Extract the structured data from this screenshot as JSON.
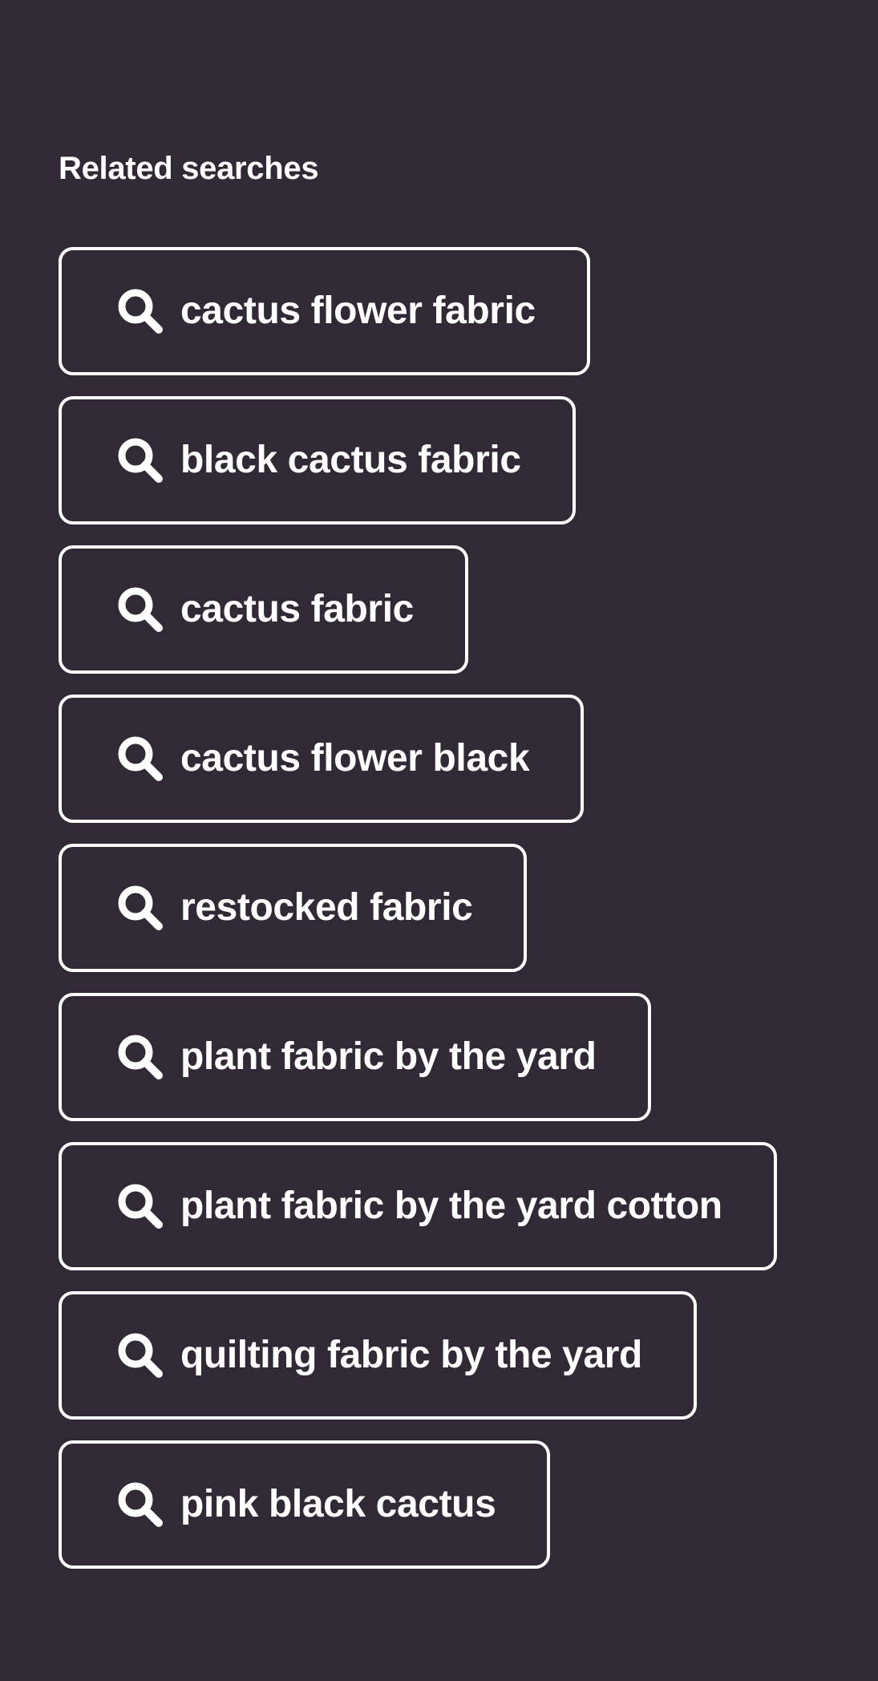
{
  "section": {
    "title": "Related searches"
  },
  "theme": {
    "background": "#312a36",
    "foreground": "#ffffff"
  },
  "related_searches": [
    {
      "label": "cactus flower fabric",
      "icon": "search-icon"
    },
    {
      "label": "black cactus fabric",
      "icon": "search-icon"
    },
    {
      "label": "cactus fabric",
      "icon": "search-icon"
    },
    {
      "label": "cactus flower black",
      "icon": "search-icon"
    },
    {
      "label": "restocked fabric",
      "icon": "search-icon"
    },
    {
      "label": "plant fabric by the yard",
      "icon": "search-icon"
    },
    {
      "label": "plant fabric by the yard cotton",
      "icon": "search-icon"
    },
    {
      "label": "quilting fabric by the yard",
      "icon": "search-icon"
    },
    {
      "label": "pink black cactus",
      "icon": "search-icon"
    }
  ]
}
